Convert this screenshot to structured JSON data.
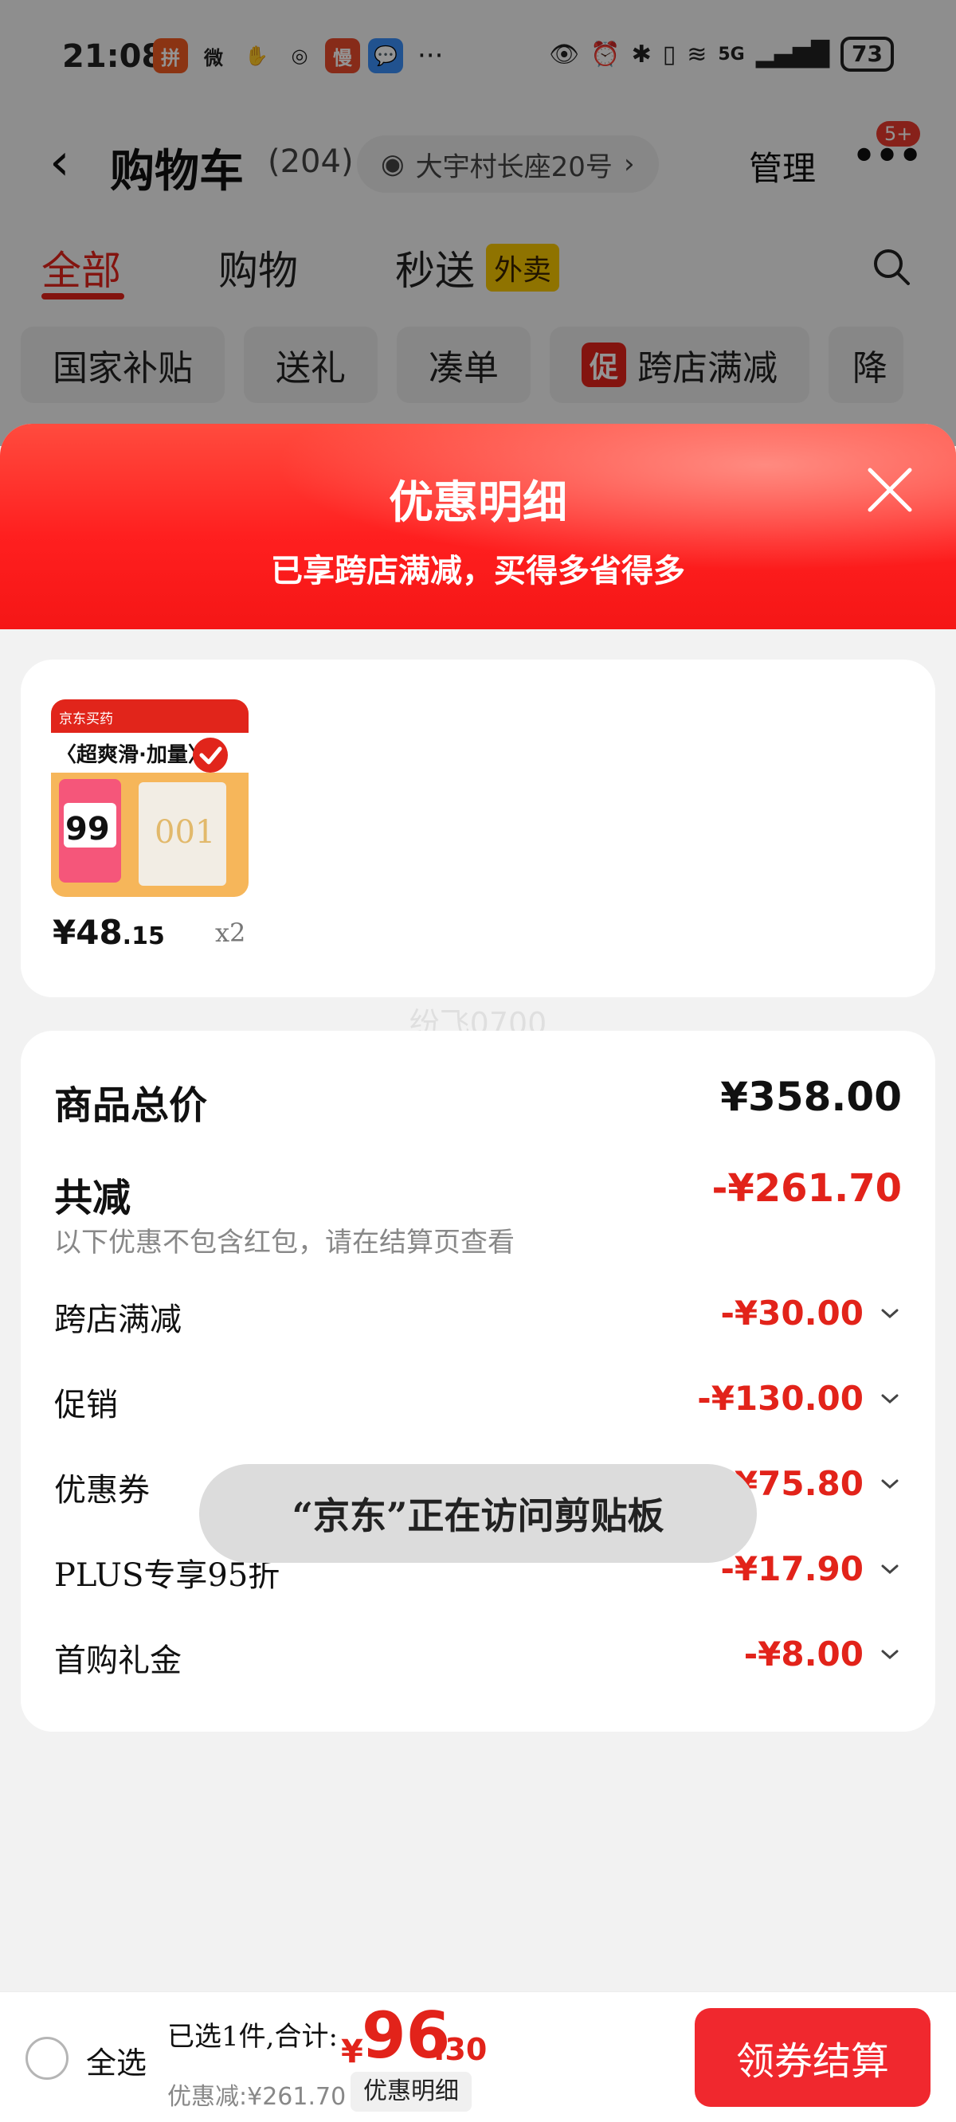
{
  "status_bar": {
    "time": "21:08",
    "apps": [
      "拼",
      "微",
      "✋",
      "◎",
      "慢",
      "💬"
    ],
    "more": "···",
    "battery": "73",
    "network": "5G"
  },
  "nav": {
    "title": "购物车",
    "count": "(204)",
    "address": "大宇村长座20号",
    "manage_label": "管理",
    "badge": "5+"
  },
  "tabs": [
    {
      "label": "全部",
      "active": true
    },
    {
      "label": "购物",
      "active": false
    },
    {
      "label": "秒送",
      "active": false
    }
  ],
  "tab_tag": "外卖",
  "chips": [
    {
      "label": "国家补贴"
    },
    {
      "label": "送礼"
    },
    {
      "label": "凑单"
    },
    {
      "label": "跨店满减",
      "tag": "促"
    },
    {
      "label": "降"
    }
  ],
  "sheet": {
    "title": "优惠明细",
    "subtitle": "已享跨店满减，买得多省得多"
  },
  "product": {
    "price_int": "¥48",
    "price_dec": ".15",
    "qty": "x2",
    "thumb_brand": "京东买药",
    "thumb_headline": "〈超爽滑·加量〉",
    "thumb_price": "99",
    "thumb_text": "001"
  },
  "watermark": "纷飞0700",
  "summary": {
    "total_label": "商品总价",
    "total_value": "¥358.00",
    "reduce_label": "共减",
    "reduce_value": "-¥261.70",
    "note": "以下优惠不包含红包，请在结算页查看",
    "items": [
      {
        "label": "跨店满减",
        "value": "-¥30.00"
      },
      {
        "label": "促销",
        "value": "-¥130.00"
      },
      {
        "label": "优惠券",
        "value": "-¥75.80"
      },
      {
        "label": "PLUS专享95折",
        "value": "-¥17.90"
      },
      {
        "label": "首购礼金",
        "value": "-¥8.00"
      }
    ]
  },
  "toast": "“京东”正在访问剪贴板",
  "bottom": {
    "select_all": "全选",
    "selected_text": "已选1件,合计:",
    "yen": "¥",
    "price_int": "96",
    "price_dec": ".30",
    "discount_text": "优惠减:¥261.70",
    "detail_btn": "优惠明细",
    "checkout_btn": "领券结算"
  },
  "colors": {
    "accent": "#e2231a",
    "checkout": "#f0282e",
    "header_gradient_top": "#ff4b3e"
  }
}
